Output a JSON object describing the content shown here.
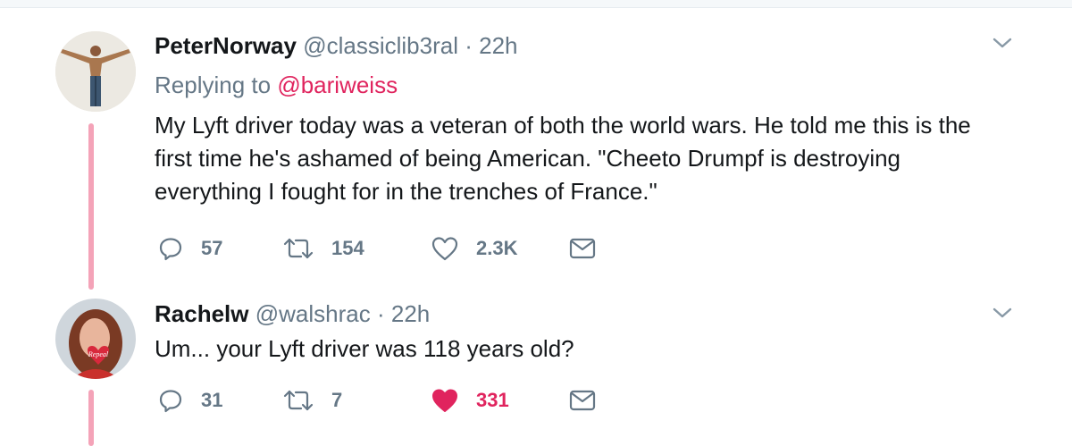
{
  "tweets": [
    {
      "author_name": "PeterNorway",
      "handle": "@classiclib3ral",
      "separator": "·",
      "time": "22h",
      "replying_prefix": "Replying to",
      "replying_to": "@bariweiss",
      "lines": [
        "My Lyft driver today was a veteran of both the world wars. He told me this is the",
        "first time he's ashamed of being American. \"Cheeto Drumpf is destroying",
        "everything I fought for in the trenches of France.\""
      ],
      "reply_count": "57",
      "retweet_count": "154",
      "like_count": "2.3K",
      "liked": false
    },
    {
      "author_name": "Rachelw",
      "handle": "@walshrac",
      "separator": "·",
      "time": "22h",
      "lines": [
        "Um... your Lyft driver was 118 years old?"
      ],
      "reply_count": "31",
      "retweet_count": "7",
      "like_count": "331",
      "liked": true,
      "avatar_badge_text": "Repeal"
    }
  ],
  "colors": {
    "thread_line": "#f4a3b8",
    "mention": "#e0245e",
    "meta_gray": "#657786",
    "like_active": "#e0245e"
  },
  "icons": [
    "reply-icon",
    "retweet-icon",
    "heart-icon",
    "mail-icon",
    "chevron-down-icon"
  ]
}
